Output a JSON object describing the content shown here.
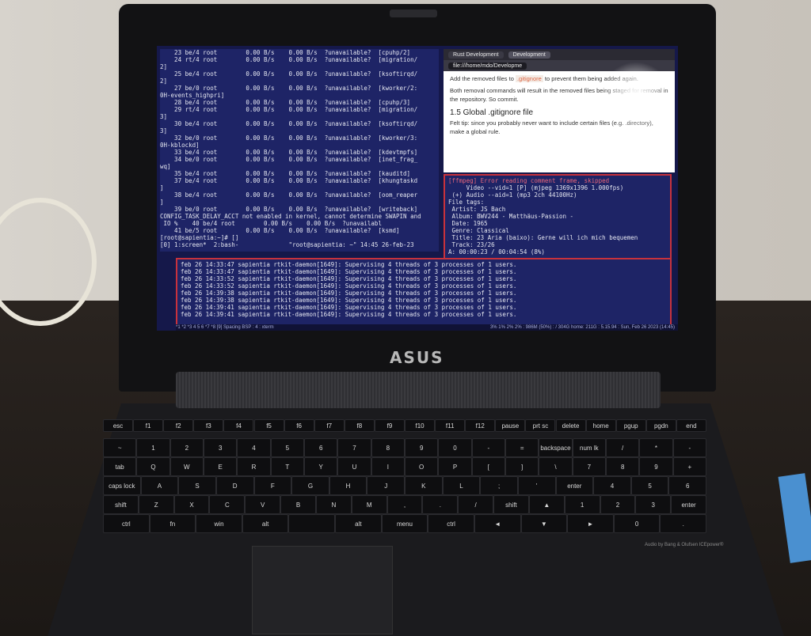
{
  "top_terminal": {
    "lines": [
      "    23 be/4 root        0.00 B/s    0.00 B/s  ?unavailable?  [cpuhp/2]",
      "    24 rt/4 root        0.00 B/s    0.00 B/s  ?unavailable?  [migration/",
      "2]",
      "    25 be/4 root        0.00 B/s    0.00 B/s  ?unavailable?  [ksoftirqd/",
      "2]",
      "    27 be/0 root        0.00 B/s    0.00 B/s  ?unavailable?  [kworker/2:",
      "0H-events_highpri]",
      "    28 be/4 root        0.00 B/s    0.00 B/s  ?unavailable?  [cpuhp/3]",
      "    29 rt/4 root        0.00 B/s    0.00 B/s  ?unavailable?  [migration/",
      "3]",
      "    30 be/4 root        0.00 B/s    0.00 B/s  ?unavailable?  [ksoftirqd/",
      "3]",
      "    32 be/0 root        0.00 B/s    0.00 B/s  ?unavailable?  [kworker/3:",
      "0H-kblockd]",
      "    33 be/4 root        0.00 B/s    0.00 B/s  ?unavailable?  [kdevtmpfs]",
      "    34 be/0 root        0.00 B/s    0.00 B/s  ?unavailable?  [inet_frag_",
      "wq]",
      "    35 be/4 root        0.00 B/s    0.00 B/s  ?unavailable?  [kauditd]",
      "    37 be/4 root        0.00 B/s    0.00 B/s  ?unavailable?  [khungtaskd",
      "]",
      "    38 be/4 root        0.00 B/s    0.00 B/s  ?unavailable?  [oom_reaper",
      "]",
      "    39 be/0 root        0.00 B/s    0.00 B/s  ?unavailable?  [writeback]",
      "CONFIG_TASK_DELAY_ACCT not enabled in kernel, cannot determine SWAPIN and",
      " IO %    40 be/4 root        0.00 B/s    0.00 B/s  ?unavailabl",
      "    41 be/5 root        0.00 B/s    0.00 B/s  ?unavailable?  [ksmd]",
      "[root@sapientia:~]# []",
      "[0] 1:screen*  2:bash-              \"root@sapientia: ~\" 14:45 26-feb-23"
    ]
  },
  "browser": {
    "tabs": [
      "Rust Development",
      "Development"
    ],
    "url": "file:///home/mdo/Developme",
    "paragraph1_pre": "Add the removed files to ",
    "paragraph1_code": ".gitignore",
    "paragraph1_post": " to prevent them being added again.",
    "paragraph2": "Both removal commands will result in the removed files being staged for removal in the repository. So commit.",
    "heading": "1.5 Global .gitignore file",
    "paragraph3": "Felt tip: since you probably never want to include certain files (e.g. .directory), make a global rule."
  },
  "media_terminal": {
    "lines": [
      "[ffmpeg] Error reading comment frame, skipped",
      "     Video --vid=1 [P] (mjpeg 1369x1396 1.000fps)",
      " (+) Audio --aid=1 (mp3 2ch 44100Hz)",
      "File tags:",
      " Artist: JS Bach",
      " Album: BWV244 - Matthäus-Passion -",
      " Date: 1965",
      " Genre: Classical",
      " Title: 23 Aria (baixo): Gerne will ich mich bequemen",
      " Track: 23/26",
      "A: 00:00:23 / 00:04:54 (8%)"
    ]
  },
  "log_terminal": {
    "lines": [
      "feb 26 14:33:47 sapientia rtkit-daemon[1649]: Supervising 4 threads of 3 processes of 1 users.",
      "feb 26 14:33:47 sapientia rtkit-daemon[1649]: Supervising 4 threads of 3 processes of 1 users.",
      "feb 26 14:33:52 sapientia rtkit-daemon[1649]: Supervising 4 threads of 3 processes of 1 users.",
      "feb 26 14:33:52 sapientia rtkit-daemon[1649]: Supervising 4 threads of 3 processes of 1 users.",
      "feb 26 14:39:38 sapientia rtkit-daemon[1649]: Supervising 4 threads of 3 processes of 1 users.",
      "feb 26 14:39:38 sapientia rtkit-daemon[1649]: Supervising 4 threads of 3 processes of 1 users.",
      "feb 26 14:39:41 sapientia rtkit-daemon[1649]: Supervising 4 threads of 3 processes of 1 users.",
      "feb 26 14:39:41 sapientia rtkit-daemon[1649]: Supervising 4 threads of 3 processes of 1 users."
    ]
  },
  "statusbar": {
    "left": "*1 *2 *3 4 5 6 *7 *8 [9]  Spacing BSP : 4 : xterm",
    "right": "3% 1% 2% 2% : 986M (50%) : / 304G home: 211G : 5.15.94 : Sun, Feb 26 2023 (14:45)"
  },
  "hardware": {
    "logo": "ASUS",
    "audio_brand": "Audio by Bang & Olufsen ICEpower®"
  },
  "keyboard": {
    "rows": [
      [
        "esc",
        "f1",
        "f2",
        "f3",
        "f4",
        "f5",
        "f6",
        "f7",
        "f8",
        "f9",
        "f10",
        "f11",
        "f12",
        "pause",
        "prt sc",
        "delete",
        "home",
        "pgup",
        "pgdn",
        "end"
      ],
      [
        "~",
        "1",
        "2",
        "3",
        "4",
        "5",
        "6",
        "7",
        "8",
        "9",
        "0",
        "-",
        "=",
        "backspace",
        "num lk",
        "/",
        "*",
        "-"
      ],
      [
        "tab",
        "Q",
        "W",
        "E",
        "R",
        "T",
        "Y",
        "U",
        "I",
        "O",
        "P",
        "[",
        "]",
        "\\",
        "7",
        "8",
        "9",
        "+"
      ],
      [
        "caps lock",
        "A",
        "S",
        "D",
        "F",
        "G",
        "H",
        "J",
        "K",
        "L",
        ";",
        "'",
        "enter",
        "4",
        "5",
        "6"
      ],
      [
        "shift",
        "Z",
        "X",
        "C",
        "V",
        "B",
        "N",
        "M",
        ",",
        ".",
        "/",
        "shift",
        "▲",
        "1",
        "2",
        "3",
        "enter"
      ],
      [
        "ctrl",
        "fn",
        "win",
        "alt",
        "",
        "alt",
        "menu",
        "ctrl",
        "◄",
        "▼",
        "►",
        "0",
        "."
      ]
    ]
  }
}
